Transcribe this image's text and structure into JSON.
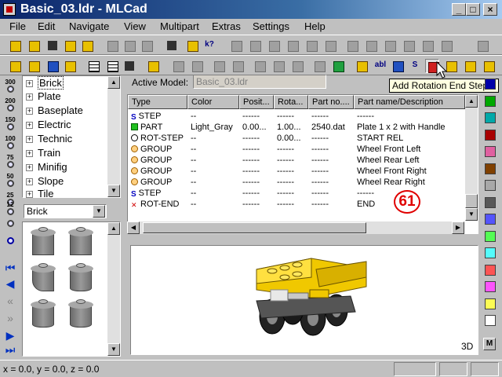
{
  "window": {
    "title": "Basic_03.ldr - MLCad",
    "buttons": [
      "_",
      "□",
      "×"
    ]
  },
  "menu": [
    "File",
    "Edit",
    "Navigate",
    "View",
    "Multipart",
    "Extras",
    "Settings",
    "Help"
  ],
  "tooltip": "Add Rotation End Step",
  "left_strip": {
    "zoom_levels": [
      "300",
      "200",
      "150",
      "100",
      "75",
      "50",
      "25",
      "12"
    ]
  },
  "tree": {
    "items": [
      "Brick",
      "Plate",
      "Baseplate",
      "Electric",
      "Technic",
      "Train",
      "Minifig",
      "Slope",
      "Tile"
    ],
    "selected": "Brick"
  },
  "parts_combo": {
    "value": "Brick"
  },
  "main": {
    "active_model_label": "Active Model:",
    "active_model_value": "Basic_03.ldr"
  },
  "list": {
    "headers": [
      "Type",
      "Color",
      "Posit...",
      "Rota...",
      "Part no....",
      "Part name/Description"
    ],
    "rows": [
      {
        "icon": "step",
        "type": "STEP",
        "color": "--",
        "pos": "------",
        "rot": "------",
        "part": "------",
        "desc": "------"
      },
      {
        "icon": "part",
        "type": "PART",
        "color": "Light_Gray",
        "pos": "0.00...",
        "rot": "1.00...",
        "part": "2540.dat",
        "desc": "Plate 1 x 2 with Handle"
      },
      {
        "icon": "rot",
        "type": "ROT-STEP",
        "color": "--",
        "pos": "------",
        "rot": "0.00...",
        "part": "------",
        "desc": "START REL"
      },
      {
        "icon": "group",
        "type": "GROUP",
        "color": "--",
        "pos": "------",
        "rot": "------",
        "part": "------",
        "desc": "Wheel Front Left"
      },
      {
        "icon": "group",
        "type": "GROUP",
        "color": "--",
        "pos": "------",
        "rot": "------",
        "part": "------",
        "desc": "Wheel Rear Left"
      },
      {
        "icon": "group",
        "type": "GROUP",
        "color": "--",
        "pos": "------",
        "rot": "------",
        "part": "------",
        "desc": "Wheel Front Right"
      },
      {
        "icon": "group",
        "type": "GROUP",
        "color": "--",
        "pos": "------",
        "rot": "------",
        "part": "------",
        "desc": "Wheel Rear Right"
      },
      {
        "icon": "step",
        "type": "STEP",
        "color": "--",
        "pos": "------",
        "rot": "------",
        "part": "------",
        "desc": "------"
      },
      {
        "icon": "rotend",
        "type": "ROT-END",
        "color": "--",
        "pos": "------",
        "rot": "------",
        "part": "------",
        "desc": "END"
      }
    ],
    "annotation": "61"
  },
  "view3d": {
    "label": "3D"
  },
  "palette": {
    "colors": [
      "#0000a8",
      "#00a800",
      "#00a8a8",
      "#a80000",
      "#e060a0",
      "#804000",
      "#a8a8a8",
      "#585858",
      "#5454fc",
      "#54fc54",
      "#54fcfc",
      "#fc5454",
      "#fc54fc",
      "#fcfc54",
      "#ffffff"
    ],
    "multi_label": "M"
  },
  "status": {
    "coords": "x = 0.0, y = 0.0, z = 0.0"
  }
}
